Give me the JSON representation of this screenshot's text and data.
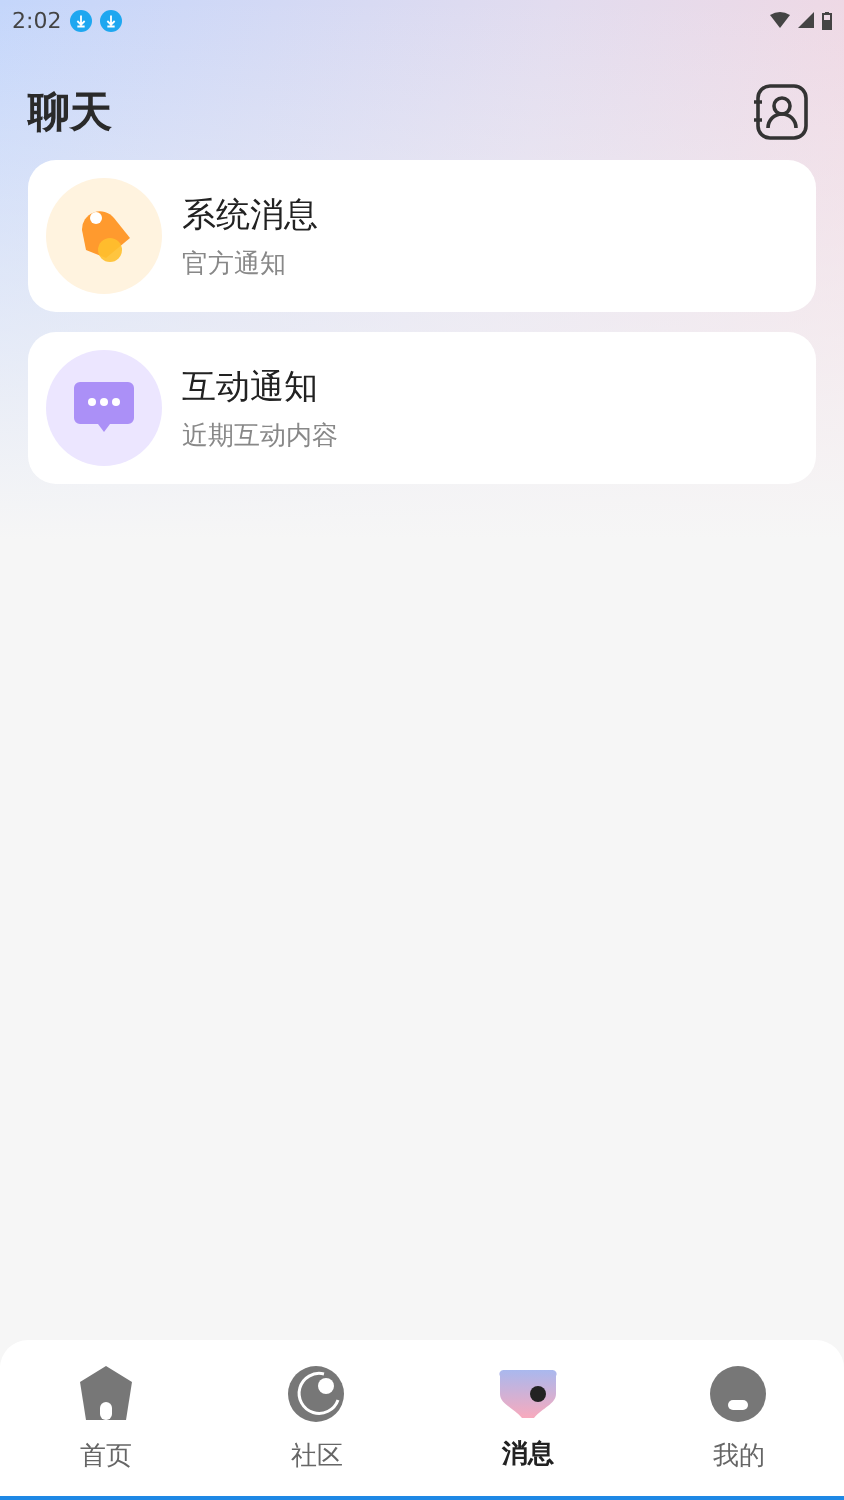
{
  "status_bar": {
    "time": "2:02"
  },
  "header": {
    "title": "聊天"
  },
  "conversations": [
    {
      "kind": "system",
      "title": "系统消息",
      "subtitle": "官方通知"
    },
    {
      "kind": "interaction",
      "title": "互动通知",
      "subtitle": "近期互动内容"
    }
  ],
  "bottom_nav": [
    {
      "kind": "home",
      "label": "首页",
      "selected": false
    },
    {
      "kind": "community",
      "label": "社区",
      "selected": false
    },
    {
      "kind": "messages",
      "label": "消息",
      "selected": true
    },
    {
      "kind": "profile",
      "label": "我的",
      "selected": false
    }
  ]
}
